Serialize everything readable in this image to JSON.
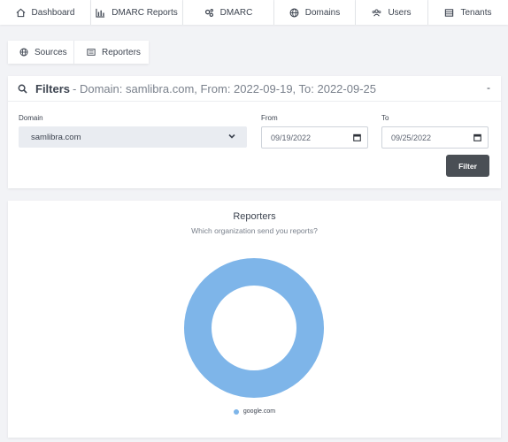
{
  "topnav": {
    "items": [
      {
        "label": "Dashboard",
        "icon": "home-icon"
      },
      {
        "label": "DMARC Reports",
        "icon": "bar-chart-icon"
      },
      {
        "label": "DMARC",
        "icon": "cogs-icon"
      },
      {
        "label": "Domains",
        "icon": "globe-icon"
      },
      {
        "label": "Users",
        "icon": "users-icon"
      },
      {
        "label": "Tenants",
        "icon": "tenants-icon"
      }
    ]
  },
  "subnav": {
    "items": [
      {
        "label": "Sources",
        "icon": "globe-icon"
      },
      {
        "label": "Reporters",
        "icon": "list-icon"
      }
    ]
  },
  "filters": {
    "title": "Filters",
    "summary": "- Domain: samlibra.com, From: 2022-09-19, To: 2022-09-25",
    "collapse": "-",
    "domain_label": "Domain",
    "domain_value": "samlibra.com",
    "from_label": "From",
    "from_value": "09/19/2022",
    "to_label": "To",
    "to_value": "09/25/2022",
    "filter_button": "Filter"
  },
  "chart_data": {
    "type": "pie",
    "title": "Reporters",
    "subtitle": "Which organization send you reports?",
    "categories": [
      "google.com"
    ],
    "values": [
      1
    ],
    "colors": [
      "#7eb5e9"
    ],
    "donut": true,
    "legend_position": "bottom"
  }
}
